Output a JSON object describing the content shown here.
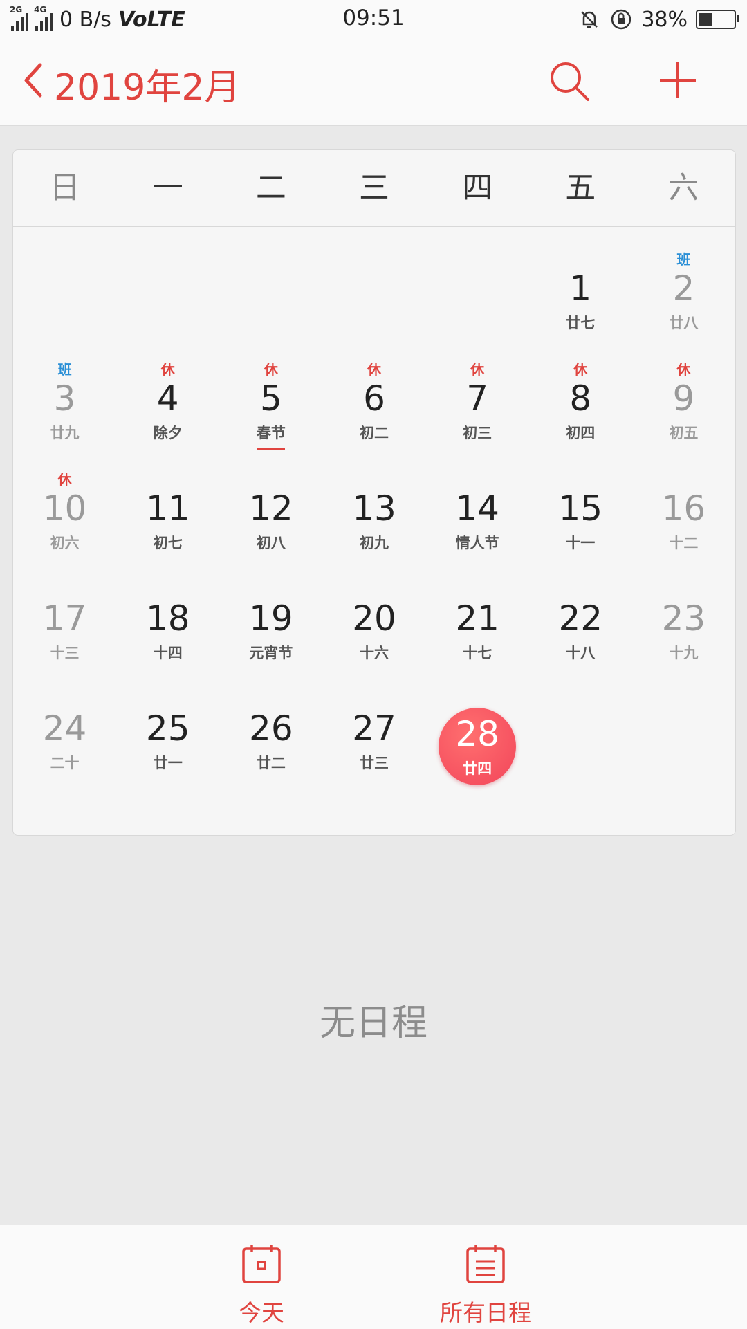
{
  "status_bar": {
    "net1": "2G",
    "net2": "4G",
    "speed": "0 B/s",
    "volte": "VoLTE",
    "time": "09:51",
    "battery_text": "38%",
    "battery_level": 0.38
  },
  "header": {
    "title": "2019年2月",
    "back_icon": "chevron-left-icon",
    "search_icon": "search-icon",
    "add_icon": "plus-icon",
    "accent": "#e0443f"
  },
  "weekdays": [
    "日",
    "一",
    "二",
    "三",
    "四",
    "五",
    "六"
  ],
  "weeks": [
    [
      {
        "num": "",
        "lunar": "",
        "tag": ""
      },
      {
        "num": "",
        "lunar": "",
        "tag": ""
      },
      {
        "num": "",
        "lunar": "",
        "tag": ""
      },
      {
        "num": "",
        "lunar": "",
        "tag": ""
      },
      {
        "num": "",
        "lunar": "",
        "tag": ""
      },
      {
        "num": "1",
        "lunar": "廿七",
        "tag": ""
      },
      {
        "num": "2",
        "lunar": "廿八",
        "tag": "班"
      }
    ],
    [
      {
        "num": "3",
        "lunar": "廿九",
        "tag": "班"
      },
      {
        "num": "4",
        "lunar": "除夕",
        "tag": "休"
      },
      {
        "num": "5",
        "lunar": "春节",
        "tag": "休"
      },
      {
        "num": "6",
        "lunar": "初二",
        "tag": "休"
      },
      {
        "num": "7",
        "lunar": "初三",
        "tag": "休"
      },
      {
        "num": "8",
        "lunar": "初四",
        "tag": "休"
      },
      {
        "num": "9",
        "lunar": "初五",
        "tag": "休"
      }
    ],
    [
      {
        "num": "10",
        "lunar": "初六",
        "tag": "休"
      },
      {
        "num": "11",
        "lunar": "初七",
        "tag": ""
      },
      {
        "num": "12",
        "lunar": "初八",
        "tag": ""
      },
      {
        "num": "13",
        "lunar": "初九",
        "tag": ""
      },
      {
        "num": "14",
        "lunar": "情人节",
        "tag": ""
      },
      {
        "num": "15",
        "lunar": "十一",
        "tag": ""
      },
      {
        "num": "16",
        "lunar": "十二",
        "tag": ""
      }
    ],
    [
      {
        "num": "17",
        "lunar": "十三",
        "tag": ""
      },
      {
        "num": "18",
        "lunar": "十四",
        "tag": ""
      },
      {
        "num": "19",
        "lunar": "元宵节",
        "tag": ""
      },
      {
        "num": "20",
        "lunar": "十六",
        "tag": ""
      },
      {
        "num": "21",
        "lunar": "十七",
        "tag": ""
      },
      {
        "num": "22",
        "lunar": "十八",
        "tag": ""
      },
      {
        "num": "23",
        "lunar": "十九",
        "tag": ""
      }
    ],
    [
      {
        "num": "24",
        "lunar": "二十",
        "tag": ""
      },
      {
        "num": "25",
        "lunar": "廿一",
        "tag": ""
      },
      {
        "num": "26",
        "lunar": "廿二",
        "tag": ""
      },
      {
        "num": "27",
        "lunar": "廿三",
        "tag": ""
      },
      {
        "num": "28",
        "lunar": "廿四",
        "tag": "",
        "today": true
      },
      {
        "num": "",
        "lunar": "",
        "tag": ""
      },
      {
        "num": "",
        "lunar": "",
        "tag": ""
      }
    ]
  ],
  "festival_underline_day": "5",
  "empty_text": "无日程",
  "bottom_nav": {
    "today_label": "今天",
    "today_icon": "calendar-today-icon",
    "all_label": "所有日程",
    "all_icon": "calendar-list-icon"
  }
}
